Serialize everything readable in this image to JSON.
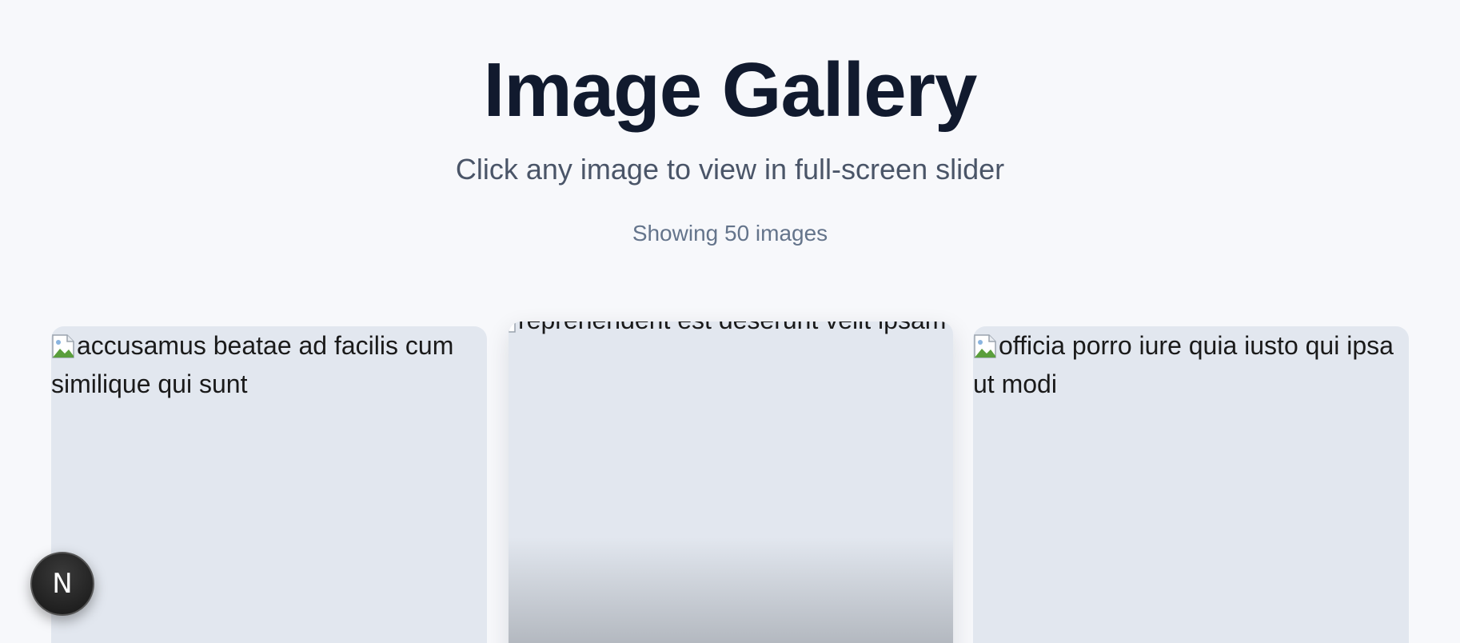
{
  "header": {
    "title": "Image Gallery",
    "subtitle": "Click any image to view in full-screen slider",
    "count_text": "Showing 50 images"
  },
  "gallery": {
    "cards": [
      {
        "alt": "accusamus beatae ad facilis cum similique qui sunt"
      },
      {
        "alt": "reprehenderit est deserunt velit ipsam"
      },
      {
        "alt": "officia porro iure quia iusto qui ipsa ut modi"
      }
    ]
  },
  "fab": {
    "letter": "N"
  },
  "colors": {
    "background": "#f7f8fb",
    "card": "#e2e7ef",
    "title": "#111a2e",
    "subtitle": "#4a5568",
    "muted": "#64748b"
  }
}
